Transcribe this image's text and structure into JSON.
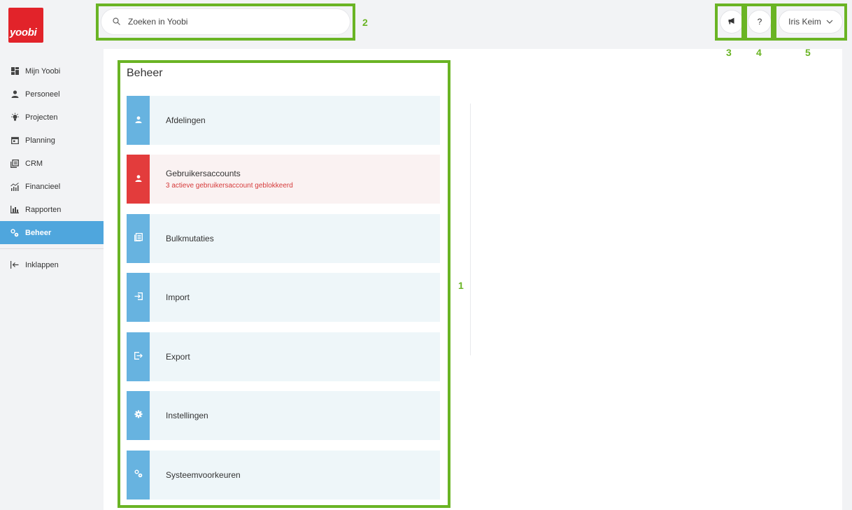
{
  "app": {
    "logo_text": "yoobi",
    "brand_color": "#e2232a",
    "accent_color": "#4fa6dd"
  },
  "sidebar": {
    "items": [
      {
        "label": "Mijn Yoobi",
        "icon": "dashboard-icon"
      },
      {
        "label": "Personeel",
        "icon": "person-icon"
      },
      {
        "label": "Projecten",
        "icon": "lightbulb-icon"
      },
      {
        "label": "Planning",
        "icon": "calendar-icon"
      },
      {
        "label": "CRM",
        "icon": "contacts-icon"
      },
      {
        "label": "Financieel",
        "icon": "finance-chart-icon"
      },
      {
        "label": "Rapporten",
        "icon": "bar-chart-icon"
      },
      {
        "label": "Beheer",
        "icon": "gears-icon",
        "active": true
      }
    ],
    "collapse_label": "Inklappen"
  },
  "search": {
    "placeholder": "Zoeken in Yoobi",
    "value": ""
  },
  "header": {
    "help_label": "?",
    "user_name": "Iris Keim"
  },
  "main": {
    "title": "Beheer",
    "cards": [
      {
        "label": "Afdelingen",
        "icon": "person-icon"
      },
      {
        "label": "Gebruikersaccounts",
        "icon": "person-icon",
        "warning": "3 actieve gebruikersaccount geblokkeerd"
      },
      {
        "label": "Bulkmutaties",
        "icon": "list-icon"
      },
      {
        "label": "Import",
        "icon": "import-icon"
      },
      {
        "label": "Export",
        "icon": "export-icon"
      },
      {
        "label": "Instellingen",
        "icon": "gear-icon"
      },
      {
        "label": "Systeemvoorkeuren",
        "icon": "gears-icon"
      }
    ]
  },
  "annotations": {
    "n1": "1",
    "n2": "2",
    "n3": "3",
    "n4": "4",
    "n5": "5",
    "color": "#6ab424"
  }
}
